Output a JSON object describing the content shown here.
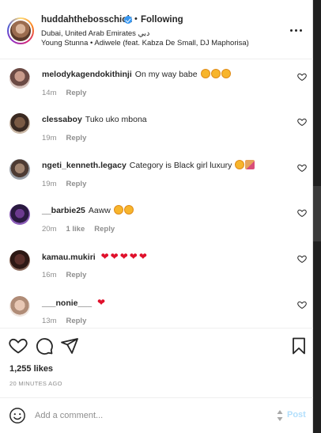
{
  "header": {
    "username": "huddahthebosschick",
    "separator": "•",
    "follow_label": "Following",
    "location": "Dubai, United Arab Emirates دبي",
    "song": "Young Stunna • Adiwele (feat. Kabza De Small, DJ Maphorisa)",
    "more_icon": "more-horizontal-icon"
  },
  "comments": [
    {
      "username": "melodykagendokithinji",
      "text": "On my way babe",
      "emoji": "😍😍😍",
      "time": "14m",
      "likes": "",
      "reply": "Reply"
    },
    {
      "username": "clessaboy",
      "text": "Tuko uko mbona",
      "emoji": "",
      "time": "19m",
      "likes": "",
      "reply": "Reply"
    },
    {
      "username": "ngeti_kenneth.legacy",
      "text": "Category is Black girl luxury",
      "emoji": "😍💅",
      "time": "19m",
      "likes": "",
      "reply": "Reply"
    },
    {
      "username": "__barbie25",
      "text": "Aaww",
      "emoji": "😍😍",
      "time": "20m",
      "likes": "1 like",
      "reply": "Reply"
    },
    {
      "username": "kamau.mukiri",
      "text": "",
      "emoji": "❤❤❤❤❤",
      "time": "16m",
      "likes": "",
      "reply": "Reply"
    },
    {
      "username": "___nonie___",
      "text": "",
      "emoji": "❤",
      "time": "13m",
      "likes": "",
      "reply": "Reply"
    }
  ],
  "actions": {
    "likes_count": "1,255 likes",
    "time_ago": "20 MINUTES AGO"
  },
  "add_comment": {
    "placeholder": "Add a comment...",
    "post_label": "Post"
  },
  "colors": {
    "accent": "#0095f6",
    "post_disabled": "#b2dffc",
    "muted": "#8e8e8e",
    "text": "#262626",
    "heart_red": "#ed4956"
  }
}
